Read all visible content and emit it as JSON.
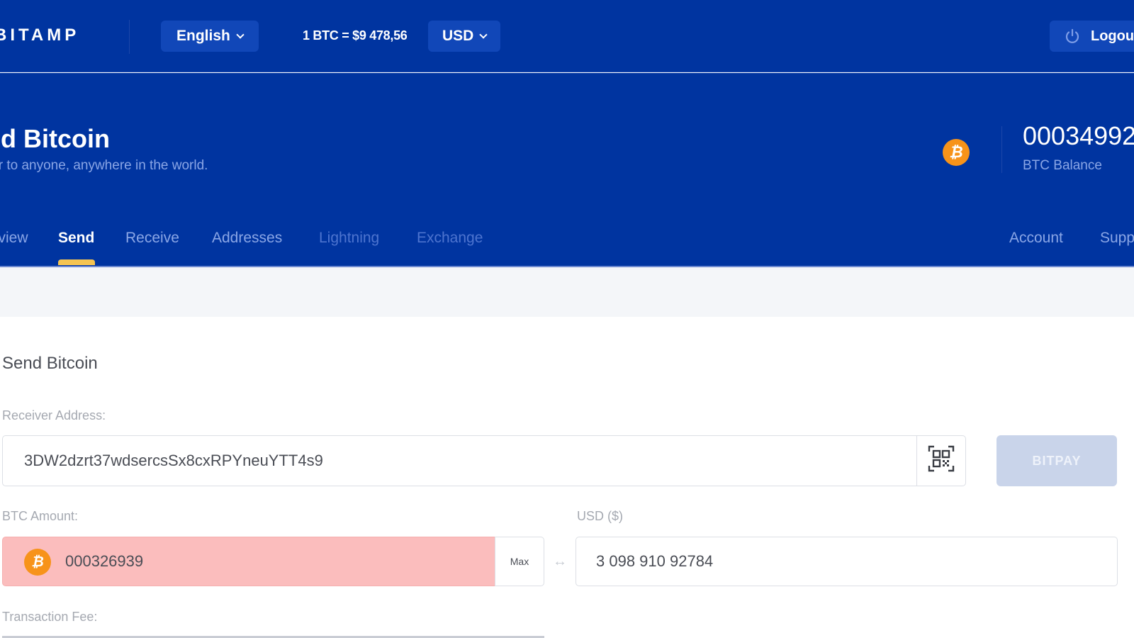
{
  "topbar": {
    "logo": "BITAMP",
    "language": "English",
    "rate": "1 BTC = $9 478,56",
    "currency": "USD",
    "logout_label": "Logout"
  },
  "hero": {
    "title": "Send Bitcoin",
    "subtitle": "Transfer to anyone, anywhere in the world.",
    "balance_value": "00034992",
    "balance_label": "BTC Balance",
    "coin_symbol": "₿"
  },
  "tabs": [
    {
      "label": "Overview",
      "state": "normal"
    },
    {
      "label": "Send",
      "state": "active"
    },
    {
      "label": "Receive",
      "state": "normal"
    },
    {
      "label": "Addresses",
      "state": "normal"
    },
    {
      "label": "Lightning",
      "state": "disabled"
    },
    {
      "label": "Exchange",
      "state": "disabled"
    },
    {
      "label": "Account",
      "state": "normal"
    },
    {
      "label": "Support",
      "state": "normal"
    }
  ],
  "form": {
    "section_title": "Send Bitcoin",
    "receiver_label": "Receiver Address:",
    "receiver_value": "3DW2dzrt37wdsercsSx8cxRPYneuYTT4s9",
    "bitpay_label": "BITPAY",
    "btc_amount_label": "BTC Amount:",
    "btc_amount_value": "000326939",
    "max_label": "Max",
    "usd_label": "USD ($)",
    "usd_value": "3 098 910 92784",
    "fee_label": "Transaction Fee:",
    "swap_symbol": "↔"
  },
  "colors": {
    "brand_blue": "#0034a0",
    "accent_yellow": "#f5c451",
    "bitcoin_orange": "#f7931a",
    "error_bg": "#fbbdbd"
  }
}
